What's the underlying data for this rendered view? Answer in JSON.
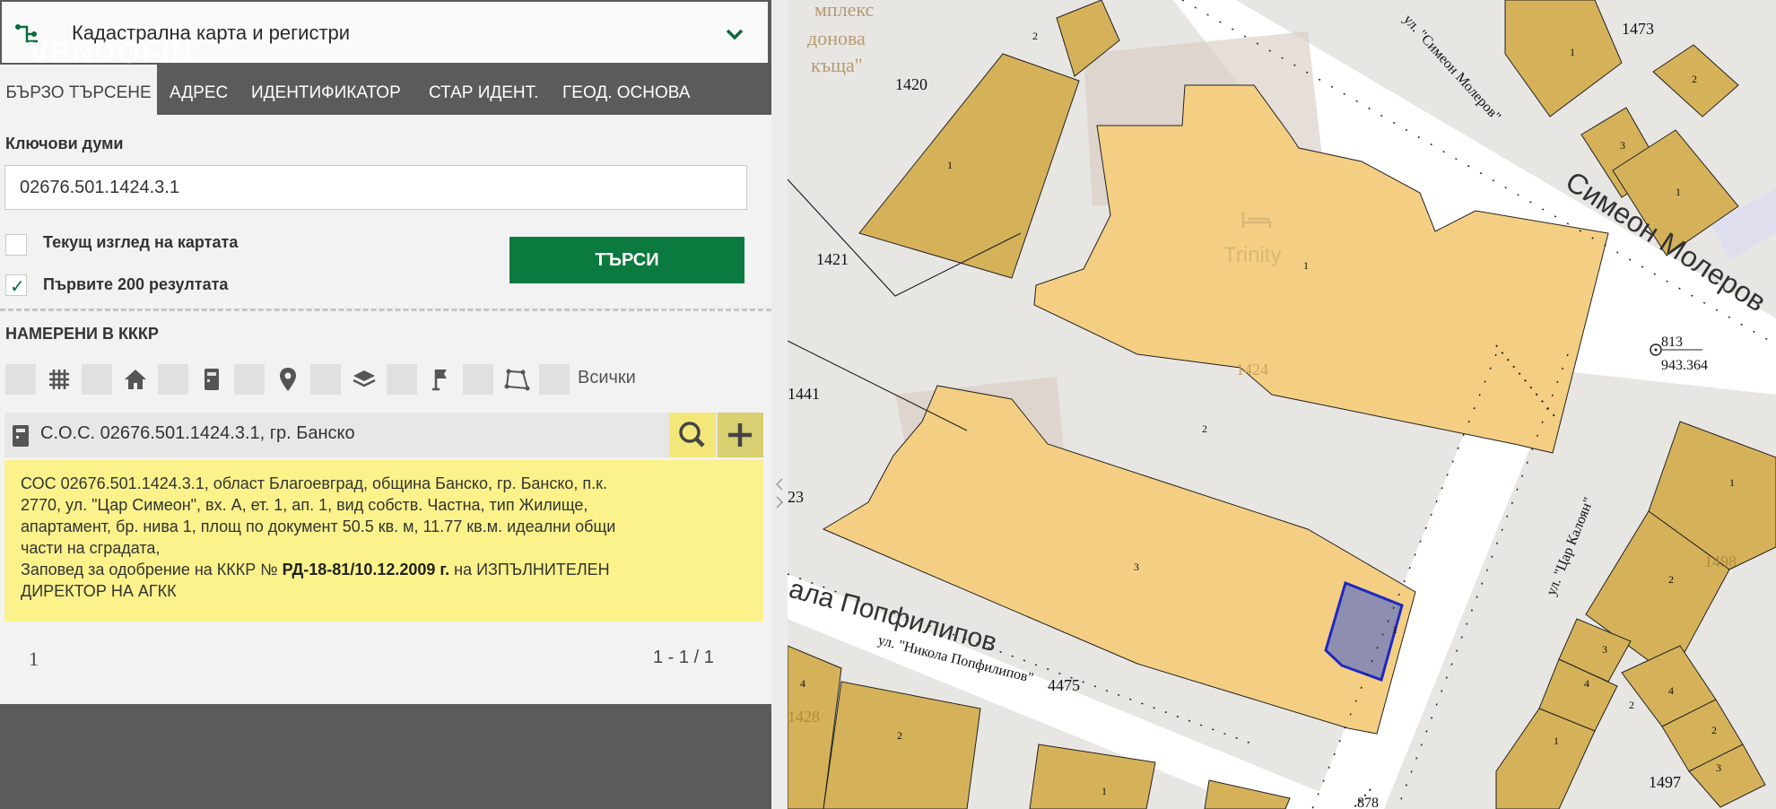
{
  "app": {
    "title": "Кадастрална карта и регистри",
    "watermark": "VENDOFIN"
  },
  "tabs": [
    {
      "label": "БЪРЗО ТЪРСЕНЕ",
      "active": true
    },
    {
      "label": "АДРЕС"
    },
    {
      "label": "ИДЕНТИФИКАТОР"
    },
    {
      "label": "СТАР ИДЕНТ."
    },
    {
      "label": "ГЕОД. ОСНОВА"
    }
  ],
  "search": {
    "keywords_label": "Ключови думи",
    "keywords_value": "02676.501.1424.3.1",
    "opt_current_view": "Текущ изглед на картата",
    "opt_current_view_checked": false,
    "opt_first_200": "Първите 200 резултата",
    "opt_first_200_checked": true,
    "button": "ТЪРСИ"
  },
  "results": {
    "heading": "НАМЕРЕНИ В КККР",
    "filters": [
      "grid-icon",
      "house-icon",
      "building-icon",
      "pin-icon",
      "layers-icon",
      "flag-icon",
      "polygon-icon"
    ],
    "all_label": "Всички",
    "item_label": "С.О.С. 02676.501.1424.3.1, гр. Банско",
    "detail_line1": "СОС 02676.501.1424.3.1, област Благоевград, община Банско, гр. Банско, п.к.",
    "detail_line2": "2770, ул. \"Цар Симеон\", вх. А, ет. 1, ап. 1, вид собств. Частна, тип Жилище,",
    "detail_line3": "апартамент, бр. нива 1, площ по документ 50.5 кв. м, 11.77 кв.м. идеални общи",
    "detail_line4": "части на сградата,",
    "order_prefix": "Заповед за одобрение на КККР №",
    "order_number": "РД-18-81/10.12.2009 г.",
    "order_suffix": "на ИЗПЪЛНИТЕЛЕН",
    "order_line2": "ДИРЕКТОР НА АГКК",
    "page": "1",
    "range": "1 - 1 / 1"
  },
  "map": {
    "street_1": "Симеон Молеров",
    "street_1_small": "ул. \"Симеон Молеров\"",
    "street_2": "ул. \"Цар Калоян\"",
    "street_3": "ала Попфилипов",
    "street_3_small": "ул. \"Никола Попфилипов\"",
    "label_complex": "мплекс",
    "label_donova": "донова",
    "label_kashta": "къща\"",
    "poi": "Trinity",
    "parcels": [
      "1473",
      "1420",
      "1421",
      "1441",
      "1424",
      "1498",
      "4475",
      "1428",
      "1497",
      "23"
    ],
    "point_id": "813",
    "point_elev": "943.364",
    "point_878": "878",
    "nums": [
      "1",
      "2",
      "3",
      "4"
    ],
    "colors": {
      "building": "#d5b25a",
      "block": "#f4cf83",
      "selected": "#8e8fb0",
      "selected_border": "#1d28c4",
      "road": "#ffffff"
    }
  }
}
